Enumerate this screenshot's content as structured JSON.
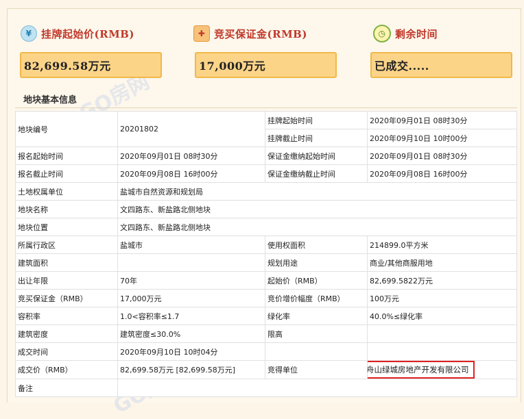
{
  "stats": [
    {
      "icon": "money-bag-icon",
      "label": "挂牌起始价(RMB)",
      "value": "82,699.58万元"
    },
    {
      "icon": "deposit-icon",
      "label": "竞买保证金(RMB)",
      "value": "17,000万元"
    },
    {
      "icon": "clock-icon",
      "label": "剩余时间",
      "value": "已成交....."
    }
  ],
  "section_title": "地块基本信息",
  "watermark": "GO房网",
  "table": {
    "plot_no_label": "地块编号",
    "plot_no_value": "20201802",
    "list_start_label": "挂牌起始时间",
    "list_start_value": "2020年09月01日 08时30分",
    "list_end_label": "挂牌截止时间",
    "list_end_value": "2020年09月10日 10时00分",
    "rows": [
      [
        "报名起始时间",
        "2020年09月01日 08时30分",
        "保证金缴纳起始时间",
        "2020年09月01日 08时30分"
      ],
      [
        "报名截止时间",
        "2020年09月08日 16时00分",
        "保证金缴纳截止时间",
        "2020年09月08日 16时00分"
      ],
      [
        "土地权属单位",
        "盐城市自然资源和规划局"
      ],
      [
        "地块名称",
        "文四路东、新盐路北侧地块"
      ],
      [
        "地块位置",
        "文四路东、新盐路北侧地块"
      ],
      [
        "所属行政区",
        "盐城市",
        "使用权面积",
        "214899.0平方米"
      ],
      [
        "建筑面积",
        "",
        "规划用途",
        "商业/其他商服用地"
      ],
      [
        "出让年限",
        "70年",
        "起始价（RMB）",
        "82,699.5822万元"
      ],
      [
        "竞买保证金（RMB）",
        "17,000万元",
        "竞价增价幅度（RMB）",
        "100万元"
      ],
      [
        "容积率",
        "1.0<容积率≤1.7",
        "绿化率",
        "40.0%≤绿化率"
      ],
      [
        "建筑密度",
        "建筑密度≤30.0%",
        "限高",
        ""
      ],
      [
        "成交时间",
        "2020年09月10日 10时04分",
        "",
        ""
      ],
      [
        "成交价（RMB）",
        "82,699.58万元 [82,699.58万元]",
        "竞得单位",
        "舟山绿城房地产开发有限公司"
      ],
      [
        "备注",
        ""
      ]
    ]
  }
}
